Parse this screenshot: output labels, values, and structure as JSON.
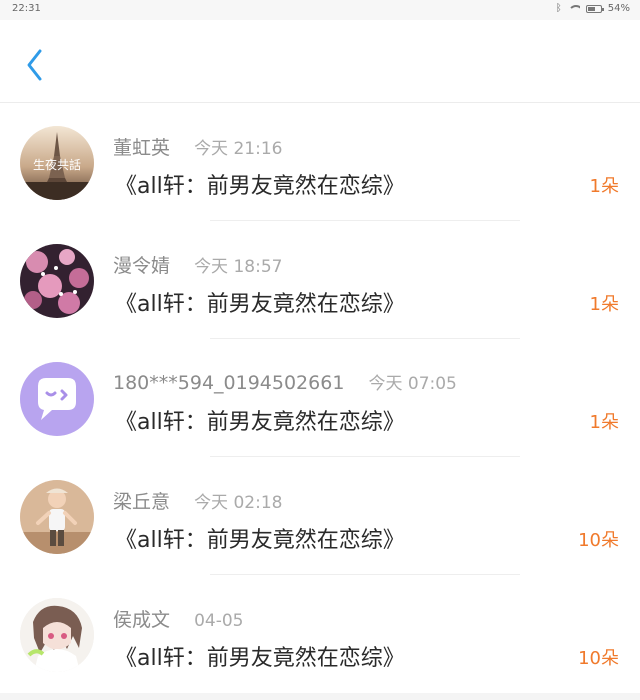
{
  "status_bar": {
    "time": "22:31",
    "battery": "54%"
  },
  "header": {
    "back_icon": "chevron-left-icon"
  },
  "items": [
    {
      "name": "董虹英",
      "time": "今天 21:16",
      "message": "《all轩：前男友竟然在恋综》",
      "count": "1朵",
      "avatar_text": "生夜共話"
    },
    {
      "name": "漫令婧",
      "time": "今天 18:57",
      "message": "《all轩：前男友竟然在恋综》",
      "count": "1朵"
    },
    {
      "name": "180***594_0194502661",
      "time": "今天 07:05",
      "message": "《all轩：前男友竟然在恋综》",
      "count": "1朵"
    },
    {
      "name": "梁丘意",
      "time": "今天 02:18",
      "message": "《all轩：前男友竟然在恋综》",
      "count": "10朵"
    },
    {
      "name": "侯成文",
      "time": "04-05",
      "message": "《all轩：前男友竟然在恋综》",
      "count": "10朵"
    }
  ],
  "colors": {
    "accent": "#2f9be8",
    "count": "#f07a2c",
    "background": "#f4f4f4"
  }
}
